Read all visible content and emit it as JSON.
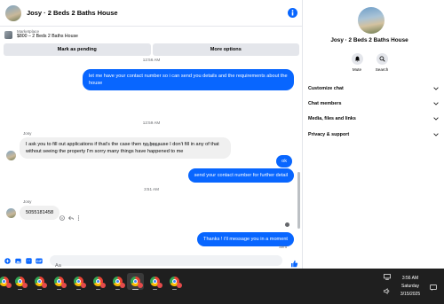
{
  "header": {
    "title": "Josy · 2 Beds 2 Baths House"
  },
  "marketplace": {
    "label": "Marketplace",
    "listing": "$800 – 2 Beds 2 Baths House"
  },
  "actions": {
    "pending": "Mark as pending",
    "more": "More options"
  },
  "messages": {
    "ts_top": "12:56 AM",
    "out1": "let me have your contact number so i can send you details and the requirements about the house",
    "ts1": "12:59 AM",
    "sender1": "Josy",
    "in1": "I ask you to fill out applications if that's the case then no because I don't fill in any of that without seeing the property I'm sorry many things have happened to me",
    "ts2": "3:29 AM",
    "out2": "ok",
    "out3": "send your contact number for further detail",
    "ts3": "3:51 AM",
    "sender2": "Josy",
    "in2": "5055181458",
    "out4": "Thanks ! i'll message you in a moment",
    "seen": "Sent"
  },
  "composer": {
    "placeholder": "Aa"
  },
  "panel": {
    "name": "Josy · 2 Beds 2 Baths House",
    "mute": "Mute",
    "search": "Search",
    "rows": [
      "Customize chat",
      "Chat members",
      "Media, files and links",
      "Privacy & support"
    ]
  },
  "taskbar": {
    "time": "3:56 AM",
    "day": "Saturday",
    "date": "3/15/2025"
  },
  "colors": {
    "accent": "#0866ff",
    "incoming": "#f0f0f0",
    "taskbar": "#1f1f1f"
  }
}
